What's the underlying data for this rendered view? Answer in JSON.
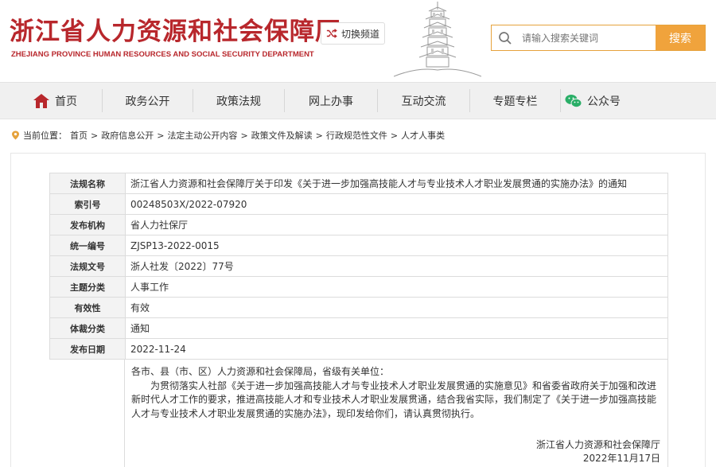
{
  "header": {
    "title_cn": "浙江省人力资源和社会保障厅",
    "title_en": "ZHEJIANG PROVINCE HUMAN RESOURCES AND SOCIAL SECURITY DEPARTMENT",
    "switch_label": "切换频道",
    "search_placeholder": "请输入搜索关键词",
    "search_button": "搜索"
  },
  "nav": {
    "items": [
      {
        "label": "首页",
        "icon": "home-icon"
      },
      {
        "label": "政务公开"
      },
      {
        "label": "政策法规"
      },
      {
        "label": "网上办事"
      },
      {
        "label": "互动交流"
      },
      {
        "label": "专题专栏"
      },
      {
        "label": "公众号",
        "icon": "wechat-icon"
      }
    ]
  },
  "breadcrumb": {
    "prefix": "当前位置：",
    "items": [
      "首页",
      "政府信息公开",
      "法定主动公开内容",
      "政策文件及解读",
      "行政规范性文件",
      "人才人事类"
    ]
  },
  "meta": [
    {
      "key": "法规名称",
      "value": "浙江省人力资源和社会保障厅关于印发《关于进一步加强高技能人才与专业技术人才职业发展贯通的实施办法》的通知"
    },
    {
      "key": "索引号",
      "value": "00248503X/2022-07920"
    },
    {
      "key": "发布机构",
      "value": "省人力社保厅"
    },
    {
      "key": "统一编号",
      "value": "ZJSP13-2022-0015"
    },
    {
      "key": "法规文号",
      "value": "浙人社发〔2022〕77号"
    },
    {
      "key": "主题分类",
      "value": "人事工作"
    },
    {
      "key": "有效性",
      "value": "有效"
    },
    {
      "key": "体裁分类",
      "value": "通知"
    },
    {
      "key": "发布日期",
      "value": "2022-11-24"
    }
  ],
  "body": {
    "salutation": "各市、县（市、区）人力资源和社会保障局，省级有关单位：",
    "paragraph": "为贯彻落实人社部《关于进一步加强高技能人才与专业技术人才职业发展贯通的实施意见》和省委省政府关于加强和改进新时代人才工作的要求，推进高技能人才和专业技术人才职业发展贯通，结合我省实际，我们制定了《关于进一步加强高技能人才与专业技术人才职业发展贯通的实施办法》，现印发给你们，请认真贯彻执行。",
    "signature": "浙江省人力资源和社会保障厅",
    "date": "2022年11月17日"
  },
  "colors": {
    "brand_red": "#b8272c",
    "accent_orange": "#f0a33c",
    "nav_bg": "#f0f0f0"
  }
}
